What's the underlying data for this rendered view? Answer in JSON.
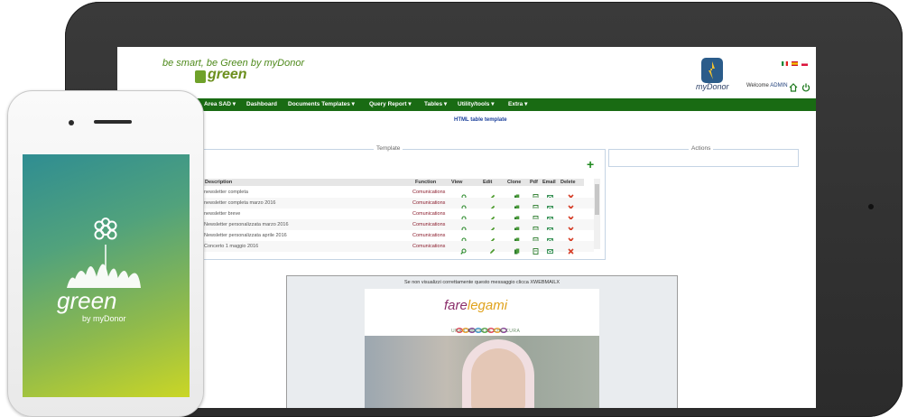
{
  "header": {
    "slogan": "be smart, be Green by myDonor",
    "logo_text": "green",
    "brand": "myDonor",
    "welcome_label": "Welcome",
    "user": "ADMIN"
  },
  "nav": {
    "items": [
      {
        "label": "Area SAD ▾"
      },
      {
        "label": "Dashboard"
      },
      {
        "label": "Documents Templates ▾"
      },
      {
        "label": "Query Report ▾"
      },
      {
        "label": "Tables ▾"
      },
      {
        "label": "Utility/tools ▾"
      },
      {
        "label": "Extra ▾"
      }
    ]
  },
  "page_title": "HTML table template",
  "template_panel": {
    "legend": "Template",
    "columns": [
      "Description",
      "Function",
      "View",
      "Edit",
      "Clone",
      "Pdf",
      "Email",
      "Delete"
    ],
    "rows": [
      {
        "description": "newsletter completa",
        "function": "Comunications"
      },
      {
        "description": "newsletter completa marzo 2016",
        "function": "Comunications"
      },
      {
        "description": "newsletter breve",
        "function": "Comunications"
      },
      {
        "description": "Newsletter personalizzata marzo 2016",
        "function": "Comunications"
      },
      {
        "description": "Newsletter personalizzata aprile 2016",
        "function": "Comunications"
      },
      {
        "description": "Concerto 1 maggio 2016",
        "function": "Comunications"
      }
    ]
  },
  "actions_panel": {
    "legend": "Actions"
  },
  "preview": {
    "note": "Se non visualizzi correttamente questo messaggio clicca XWEBMAILX",
    "title_main": "fare",
    "title_accent": "legami",
    "subtitle": "UNA COMUNITÀ CHE CURA"
  },
  "phone": {
    "app_name": "green",
    "app_by": "by myDonor"
  },
  "colors": {
    "nav": "#196b13",
    "accent_green": "#4f8a1c",
    "title_blue": "#1a3f9a",
    "function_red": "#8a1c2c"
  }
}
